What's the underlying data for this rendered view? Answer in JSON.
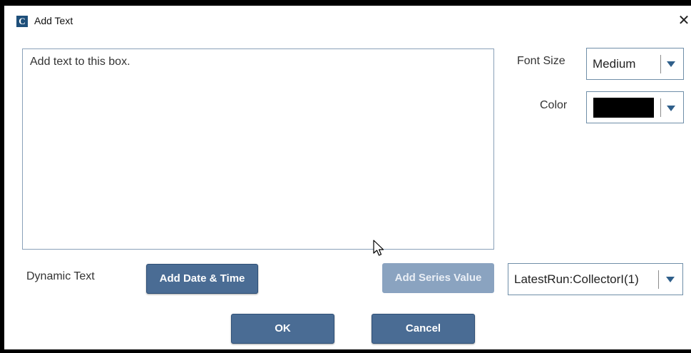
{
  "window": {
    "title": "Add Text",
    "app_icon_letter": "C",
    "close_icon": "close-icon"
  },
  "editor": {
    "text": "Add text to this box."
  },
  "font_size": {
    "label": "Font Size",
    "selected": "Medium"
  },
  "color": {
    "label": "Color",
    "selected_hex": "#000000"
  },
  "dynamic_text": {
    "label": "Dynamic Text",
    "add_date_time_label": "Add Date & Time",
    "add_series_value_label": "Add Series Value",
    "series_selected": "LatestRun:CollectorI(1)"
  },
  "footer": {
    "ok_label": "OK",
    "cancel_label": "Cancel"
  },
  "colors": {
    "button_primary": "#4a6c94",
    "button_disabled": "#8aa3c0",
    "dropdown_arrow": "#2f5f8a",
    "app_icon_bg": "#1e4f7a"
  }
}
